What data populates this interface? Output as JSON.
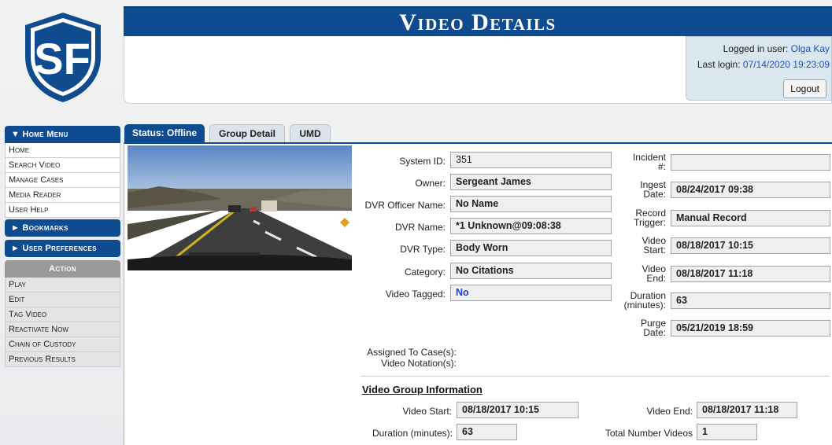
{
  "page": {
    "title": "Video Details"
  },
  "login": {
    "user_label": "Logged in user:",
    "user_name": "Olga Kay",
    "last_login_label": "Last login:",
    "last_login_value": "07/14/2020 19:23:09",
    "logout_label": "Logout"
  },
  "sidebar": {
    "home_menu": "▼ Home Menu",
    "items": [
      "Home",
      "Search Video",
      "Manage Cases",
      "Media Reader",
      "User Help"
    ],
    "bookmarks": "► Bookmarks",
    "user_prefs": "► User Preferences",
    "action_title": "Action",
    "actions": [
      "Play",
      "Edit",
      "Tag Video",
      "Reactivate Now",
      "Chain of Custody",
      "Previous Results"
    ]
  },
  "tabs": [
    "Status: Offline",
    "Group Detail",
    "UMD"
  ],
  "details": {
    "system_id_label": "System ID:",
    "system_id": "351",
    "owner_label": "Owner:",
    "owner": "Sergeant James",
    "dvr_officer_label": "DVR Officer Name:",
    "dvr_officer": "No Name",
    "dvr_name_label": "DVR Name:",
    "dvr_name": "*1 Unknown@09:08:38",
    "dvr_type_label": "DVR Type:",
    "dvr_type": "Body Worn",
    "category_label": "Category:",
    "category": "No Citations",
    "tagged_label": "Video Tagged:",
    "tagged": "No",
    "incident_label_1": "Incident",
    "incident_label_2": "#:",
    "incident": "",
    "ingest_label_1": "Ingest",
    "ingest_label_2": "Date:",
    "ingest": "08/24/2017 09:38",
    "trigger_label_1": "Record",
    "trigger_label_2": "Trigger:",
    "trigger": "Manual Record",
    "vstart_label_1": "Video",
    "vstart_label_2": "Start:",
    "vstart": "08/18/2017 10:15",
    "vend_label_1": "Video",
    "vend_label_2": "End:",
    "vend": "08/18/2017 11:18",
    "duration_label_1": "Duration",
    "duration_label_2": "(minutes):",
    "duration": "63",
    "purge_label_1": "Purge",
    "purge_label_2": "Date:",
    "purge": "05/21/2019 18:59",
    "assigned_label": "Assigned To Case(s):",
    "notation_label": "Video Notation(s):"
  },
  "group": {
    "title": "Video Group Information",
    "start_label": "Video Start:",
    "start": "08/18/2017 10:15",
    "end_label": "Video End:",
    "end": "08/18/2017 11:18",
    "duration_label": "Duration (minutes):",
    "duration": "63",
    "total_label": "Total Number Videos",
    "total": "1"
  },
  "colors": {
    "brand_blue": "#0f4c8f",
    "link_blue": "#1f4fc4"
  }
}
